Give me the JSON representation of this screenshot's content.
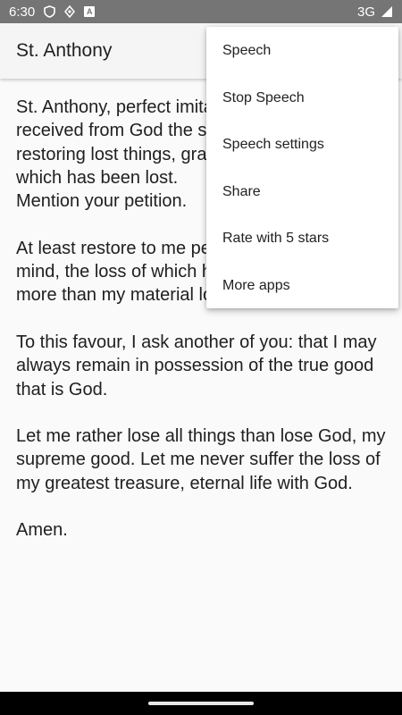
{
  "status_bar": {
    "time": "6:30",
    "network": "3G",
    "icons": [
      "shield-icon",
      "location-icon",
      "text-icon",
      "signal-icon"
    ]
  },
  "app_bar": {
    "title": "St. Anthony"
  },
  "content": {
    "paragraphs": [
      "St. Anthony, perfect imitator of Jesus, who received from God the special power of restoring lost things, grant that I may find that which has been lost.\nMention your petition.",
      "At least restore to me peace and tranquillity of mind, the loss of which has afflicted me even more than my material loss.",
      "To this favour, I ask another of you: that I may always remain in possession of the true good that is God.",
      "Let me rather lose all things than lose God, my supreme good. Let me never suffer the loss of my greatest treasure, eternal life with God.",
      "Amen."
    ]
  },
  "overflow_menu": {
    "items": [
      {
        "label": "Speech"
      },
      {
        "label": "Stop Speech"
      },
      {
        "label": "Speech settings"
      },
      {
        "label": "Share"
      },
      {
        "label": "Rate with 5 stars"
      },
      {
        "label": "More apps"
      }
    ]
  },
  "colors": {
    "status_bar": "#757575",
    "app_bar": "#f5f5f5",
    "background": "#fafafa",
    "nav_bar": "#000000"
  }
}
